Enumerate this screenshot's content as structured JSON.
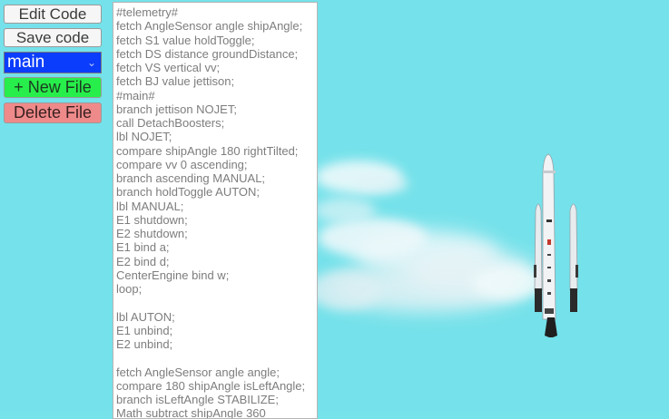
{
  "toolbar": {
    "edit_label": "Edit Code",
    "save_label": "Save code",
    "selected_file": "main",
    "new_file_label": "+ New File",
    "delete_file_label": "Delete File"
  },
  "colors": {
    "sky": "#75e1ea",
    "new_file_button": "#27ee4a",
    "delete_file_button": "#ef8a8a",
    "file_selector": "#0b3dfc"
  },
  "icons": {
    "file_selector_dropdown": "chevron-down-icon"
  },
  "editor": {
    "lines": [
      "#telemetry#",
      "fetch AngleSensor angle shipAngle;",
      "fetch S1 value holdToggle;",
      "fetch DS distance groundDistance;",
      "fetch VS vertical vv;",
      "fetch BJ value jettison;",
      "#main#",
      "branch jettison NOJET;",
      "call DetachBoosters;",
      "lbl NOJET;",
      "compare shipAngle 180 rightTilted;",
      "compare vv 0 ascending;",
      "branch ascending MANUAL;",
      "branch holdToggle AUTON;",
      "lbl MANUAL;",
      "E1 shutdown;",
      "E2 shutdown;",
      "E1 bind a;",
      "E2 bind d;",
      "CenterEngine bind w;",
      "loop;",
      "",
      "lbl AUTON;",
      "E1 unbind;",
      "E2 unbind;",
      "",
      "fetch AngleSensor angle angle;",
      "compare 180 shipAngle isLeftAngle;",
      "branch isLeftAngle STABILIZE;",
      "Math subtract shipAngle 360"
    ]
  }
}
